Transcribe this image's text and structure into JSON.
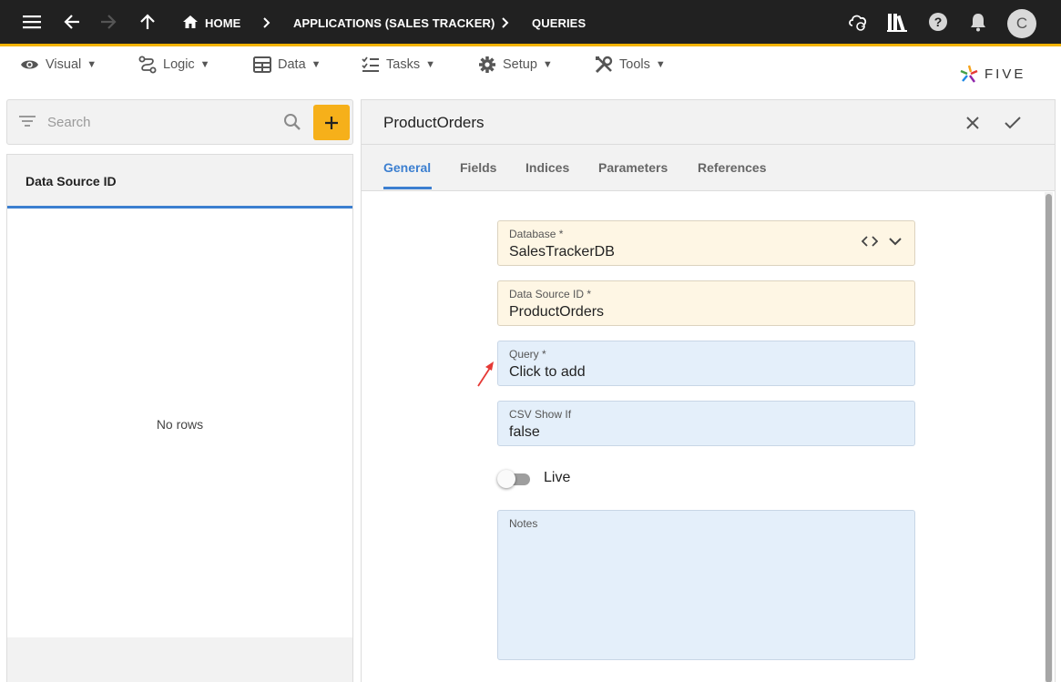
{
  "topbar": {
    "breadcrumbs": [
      "HOME",
      "APPLICATIONS (SALES TRACKER)",
      "QUERIES"
    ],
    "avatar_letter": "C",
    "accent_color": "#f5b400",
    "icons": [
      "menu-icon",
      "back-arrow-icon",
      "forward-arrow-icon",
      "up-arrow-icon",
      "home-icon",
      "cloud-sync-icon",
      "library-icon",
      "help-icon",
      "bell-icon"
    ]
  },
  "menu": {
    "items": [
      {
        "label": "Visual",
        "icon": "eye-icon"
      },
      {
        "label": "Logic",
        "icon": "logic-icon"
      },
      {
        "label": "Data",
        "icon": "table-icon"
      },
      {
        "label": "Tasks",
        "icon": "checklist-icon"
      },
      {
        "label": "Setup",
        "icon": "gear-icon"
      },
      {
        "label": "Tools",
        "icon": "tools-icon"
      }
    ],
    "caret": "▼",
    "logo_text": "FIVE"
  },
  "left": {
    "search_placeholder": "Search",
    "column_header": "Data Source ID",
    "empty_text": "No rows",
    "add_button_color": "#f6b01a"
  },
  "form": {
    "title": "ProductOrders",
    "tabs": [
      "General",
      "Fields",
      "Indices",
      "Parameters",
      "References"
    ],
    "active_tab": "General",
    "fields": {
      "database": {
        "label": "Database *",
        "value": "SalesTrackerDB"
      },
      "data_source_id": {
        "label": "Data Source ID *",
        "value": "ProductOrders"
      },
      "query": {
        "label": "Query *",
        "value": "Click to add"
      },
      "csv_show_if": {
        "label": "CSV Show If",
        "value": "false"
      },
      "notes": {
        "label": "Notes",
        "value": ""
      }
    },
    "live": {
      "label": "Live",
      "on": false
    },
    "accent_color": "#3c7fd0"
  }
}
